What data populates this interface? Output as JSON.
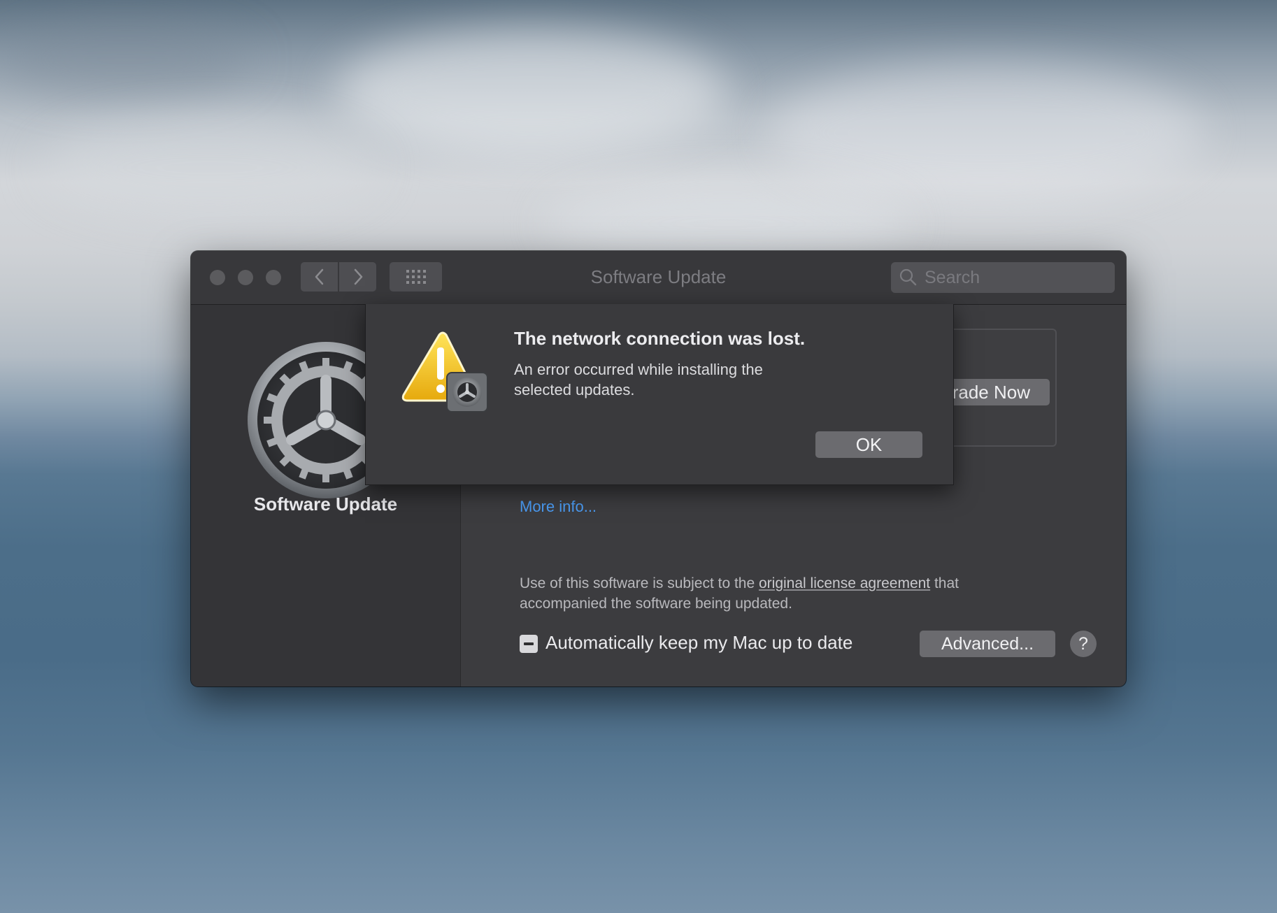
{
  "window": {
    "title": "Software Update",
    "search_placeholder": "Search"
  },
  "sidebar": {
    "title": "Software Update"
  },
  "main": {
    "upgrade_button": "Upgrade Now",
    "more_info_link": "More info...",
    "license_prefix": "Use of this software is subject to the ",
    "license_link": "original license agreement",
    "license_suffix": " that accompanied the software being updated.",
    "auto_update_label": "Automatically keep my Mac up to date",
    "advanced_button": "Advanced...",
    "help_button": "?"
  },
  "alert": {
    "title": "The network connection was lost.",
    "message": "An error occurred while installing the selected updates.",
    "ok_button": "OK"
  },
  "colors": {
    "window_bg": "#3c3c3f",
    "link": "#4b9cf4",
    "button": "#6b6b6f",
    "warning": "#f2c01f"
  },
  "icons": [
    "back-chevron-icon",
    "forward-chevron-icon",
    "grid-icon",
    "search-icon",
    "gear-icon",
    "warning-icon"
  ]
}
